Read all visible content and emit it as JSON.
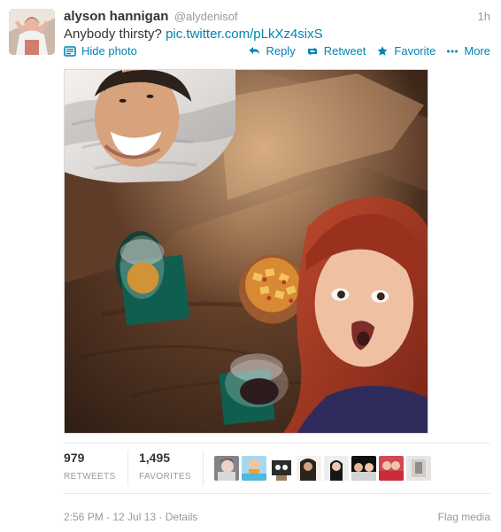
{
  "tweet": {
    "author": {
      "display_name": "alyson hannigan",
      "screen_name": "@alydenisof",
      "avatar_icon": "avatar-photo"
    },
    "time_ago": "1h",
    "text": {
      "prefix": "Anybody thirsty?",
      "link": "pic.twitter.com/pLkXz4sixS"
    }
  },
  "actions": {
    "hide_photo_label": "Hide photo",
    "reply_label": "Reply",
    "retweet_label": "Retweet",
    "favorite_label": "Favorite",
    "more_label": "More"
  },
  "stats": {
    "retweets": {
      "value": "979",
      "label": "RETWEETS"
    },
    "favorites": {
      "value": "1,495",
      "label": "FAVORITES"
    }
  },
  "footer": {
    "timestamp": "2:56 PM - 12 Jul 13",
    "separator": " · ",
    "details_label": "Details",
    "flag_media_label": "Flag media"
  },
  "colors": {
    "link": "#0084b4",
    "muted": "#999999",
    "text": "#333333",
    "divider": "#e8e8e8"
  },
  "icons": {
    "hide_photo": "photo-icon",
    "reply": "reply-arrow-icon",
    "retweet": "retweet-arrows-icon",
    "favorite": "star-icon",
    "more": "ellipsis-icon"
  }
}
